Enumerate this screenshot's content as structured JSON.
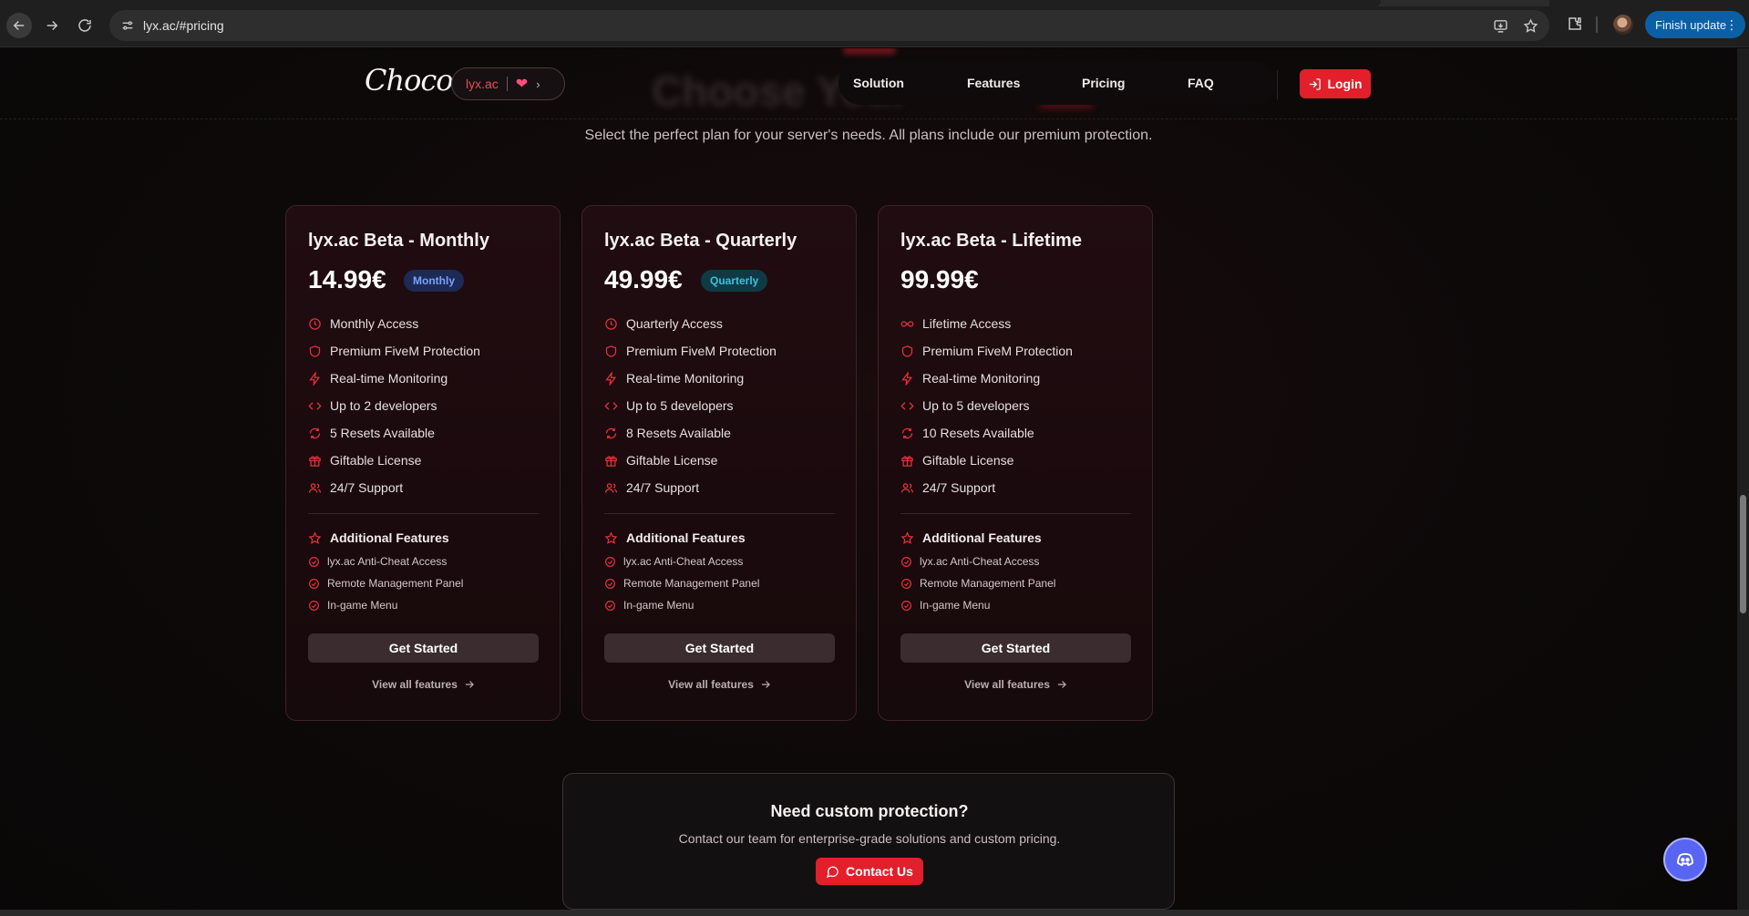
{
  "browser": {
    "url": "lyx.ac/#pricing",
    "finish_update_label": "Finish update",
    "menu_glyph": "⋮"
  },
  "header": {
    "logo_text": "Choco",
    "pill_label": "lyx.ac",
    "pill_heart": "❤",
    "pill_chevron": "›",
    "ghost_title": "Choose Your",
    "nav": [
      "Solution",
      "Features",
      "Pricing",
      "FAQ"
    ],
    "login_label": "Login"
  },
  "subtitle": "Select the perfect plan for your server's needs. All plans include our premium protection.",
  "plans": [
    {
      "title": "lyx.ac Beta - Monthly",
      "price": "14.99€",
      "badge": "Monthly",
      "features": [
        {
          "icon": "clock-icon",
          "text": "Monthly Access"
        },
        {
          "icon": "shield-icon",
          "text": "Premium FiveM Protection"
        },
        {
          "icon": "bolt-icon",
          "text": "Real-time Monitoring"
        },
        {
          "icon": "code-icon",
          "text": "Up to 2 developers"
        },
        {
          "icon": "refresh-icon",
          "text": "5 Resets Available"
        },
        {
          "icon": "gift-icon",
          "text": "Giftable License"
        },
        {
          "icon": "users-icon",
          "text": "24/7 Support"
        }
      ],
      "additional_title": "Additional Features",
      "additional": [
        "lyx.ac Anti-Cheat Access",
        "Remote Management Panel",
        "In-game Menu"
      ],
      "cta": "Get Started",
      "view_all": "View all features"
    },
    {
      "title": "lyx.ac Beta - Quarterly",
      "price": "49.99€",
      "badge": "Quarterly",
      "features": [
        {
          "icon": "clock-icon",
          "text": "Quarterly Access"
        },
        {
          "icon": "shield-icon",
          "text": "Premium FiveM Protection"
        },
        {
          "icon": "bolt-icon",
          "text": "Real-time Monitoring"
        },
        {
          "icon": "code-icon",
          "text": "Up to 5 developers"
        },
        {
          "icon": "refresh-icon",
          "text": "8 Resets Available"
        },
        {
          "icon": "gift-icon",
          "text": "Giftable License"
        },
        {
          "icon": "users-icon",
          "text": "24/7 Support"
        }
      ],
      "additional_title": "Additional Features",
      "additional": [
        "lyx.ac Anti-Cheat Access",
        "Remote Management Panel",
        "In-game Menu"
      ],
      "cta": "Get Started",
      "view_all": "View all features"
    },
    {
      "title": "lyx.ac Beta - Lifetime",
      "price": "99.99€",
      "badge": "",
      "features": [
        {
          "icon": "infinity-icon",
          "text": "Lifetime Access"
        },
        {
          "icon": "shield-icon",
          "text": "Premium FiveM Protection"
        },
        {
          "icon": "bolt-icon",
          "text": "Real-time Monitoring"
        },
        {
          "icon": "code-icon",
          "text": "Up to 5 developers"
        },
        {
          "icon": "refresh-icon",
          "text": "10 Resets Available"
        },
        {
          "icon": "gift-icon",
          "text": "Giftable License"
        },
        {
          "icon": "users-icon",
          "text": "24/7 Support"
        }
      ],
      "additional_title": "Additional Features",
      "additional": [
        "lyx.ac Anti-Cheat Access",
        "Remote Management Panel",
        "In-game Menu"
      ],
      "cta": "Get Started",
      "view_all": "View all features"
    }
  ],
  "custom": {
    "title": "Need custom protection?",
    "subtitle": "Contact our team for enterprise-grade solutions and custom pricing.",
    "button": "Contact Us"
  },
  "colors": {
    "accent": "#e21f2b",
    "background": "#0b0909",
    "card_bg": "#1e0b0f",
    "badge_monthly": "#7aa2ff",
    "badge_quarterly": "#36c2e0",
    "discord": "#5865f2"
  }
}
